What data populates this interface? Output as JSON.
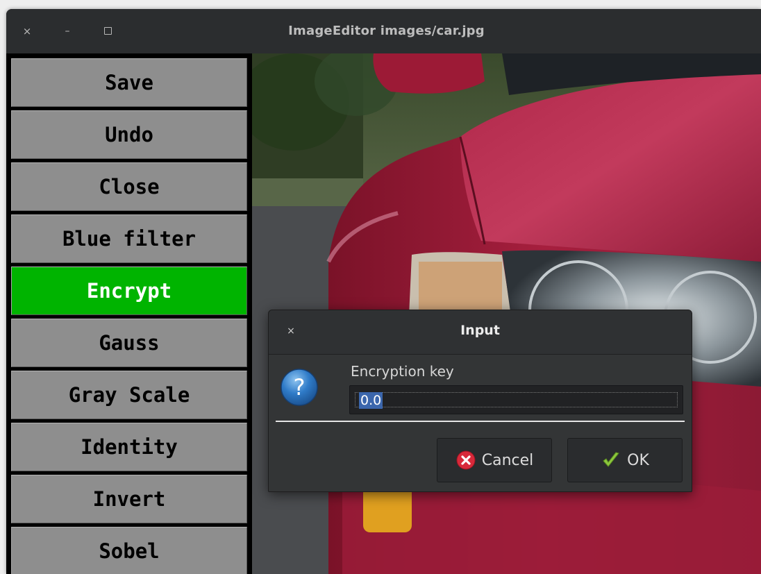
{
  "window": {
    "title": "ImageEditor images/car.jpg",
    "controls": {
      "close": "×",
      "minimize": "–"
    }
  },
  "sidebar": {
    "items": [
      {
        "label": "Save",
        "active": false
      },
      {
        "label": "Undo",
        "active": false
      },
      {
        "label": "Close",
        "active": false
      },
      {
        "label": "Blue filter",
        "active": false
      },
      {
        "label": "Encrypt",
        "active": true
      },
      {
        "label": "Gauss",
        "active": false
      },
      {
        "label": "Gray Scale",
        "active": false
      },
      {
        "label": "Identity",
        "active": false
      },
      {
        "label": "Invert",
        "active": false
      },
      {
        "label": "Sobel",
        "active": false
      }
    ],
    "colors": {
      "button": "#8e8e8e",
      "active": "#00b400"
    }
  },
  "dialog": {
    "title": "Input",
    "close_glyph": "×",
    "label": "Encryption key",
    "input_value": "0.0",
    "icon": "question-icon",
    "buttons": {
      "cancel": "Cancel",
      "ok": "OK"
    }
  }
}
